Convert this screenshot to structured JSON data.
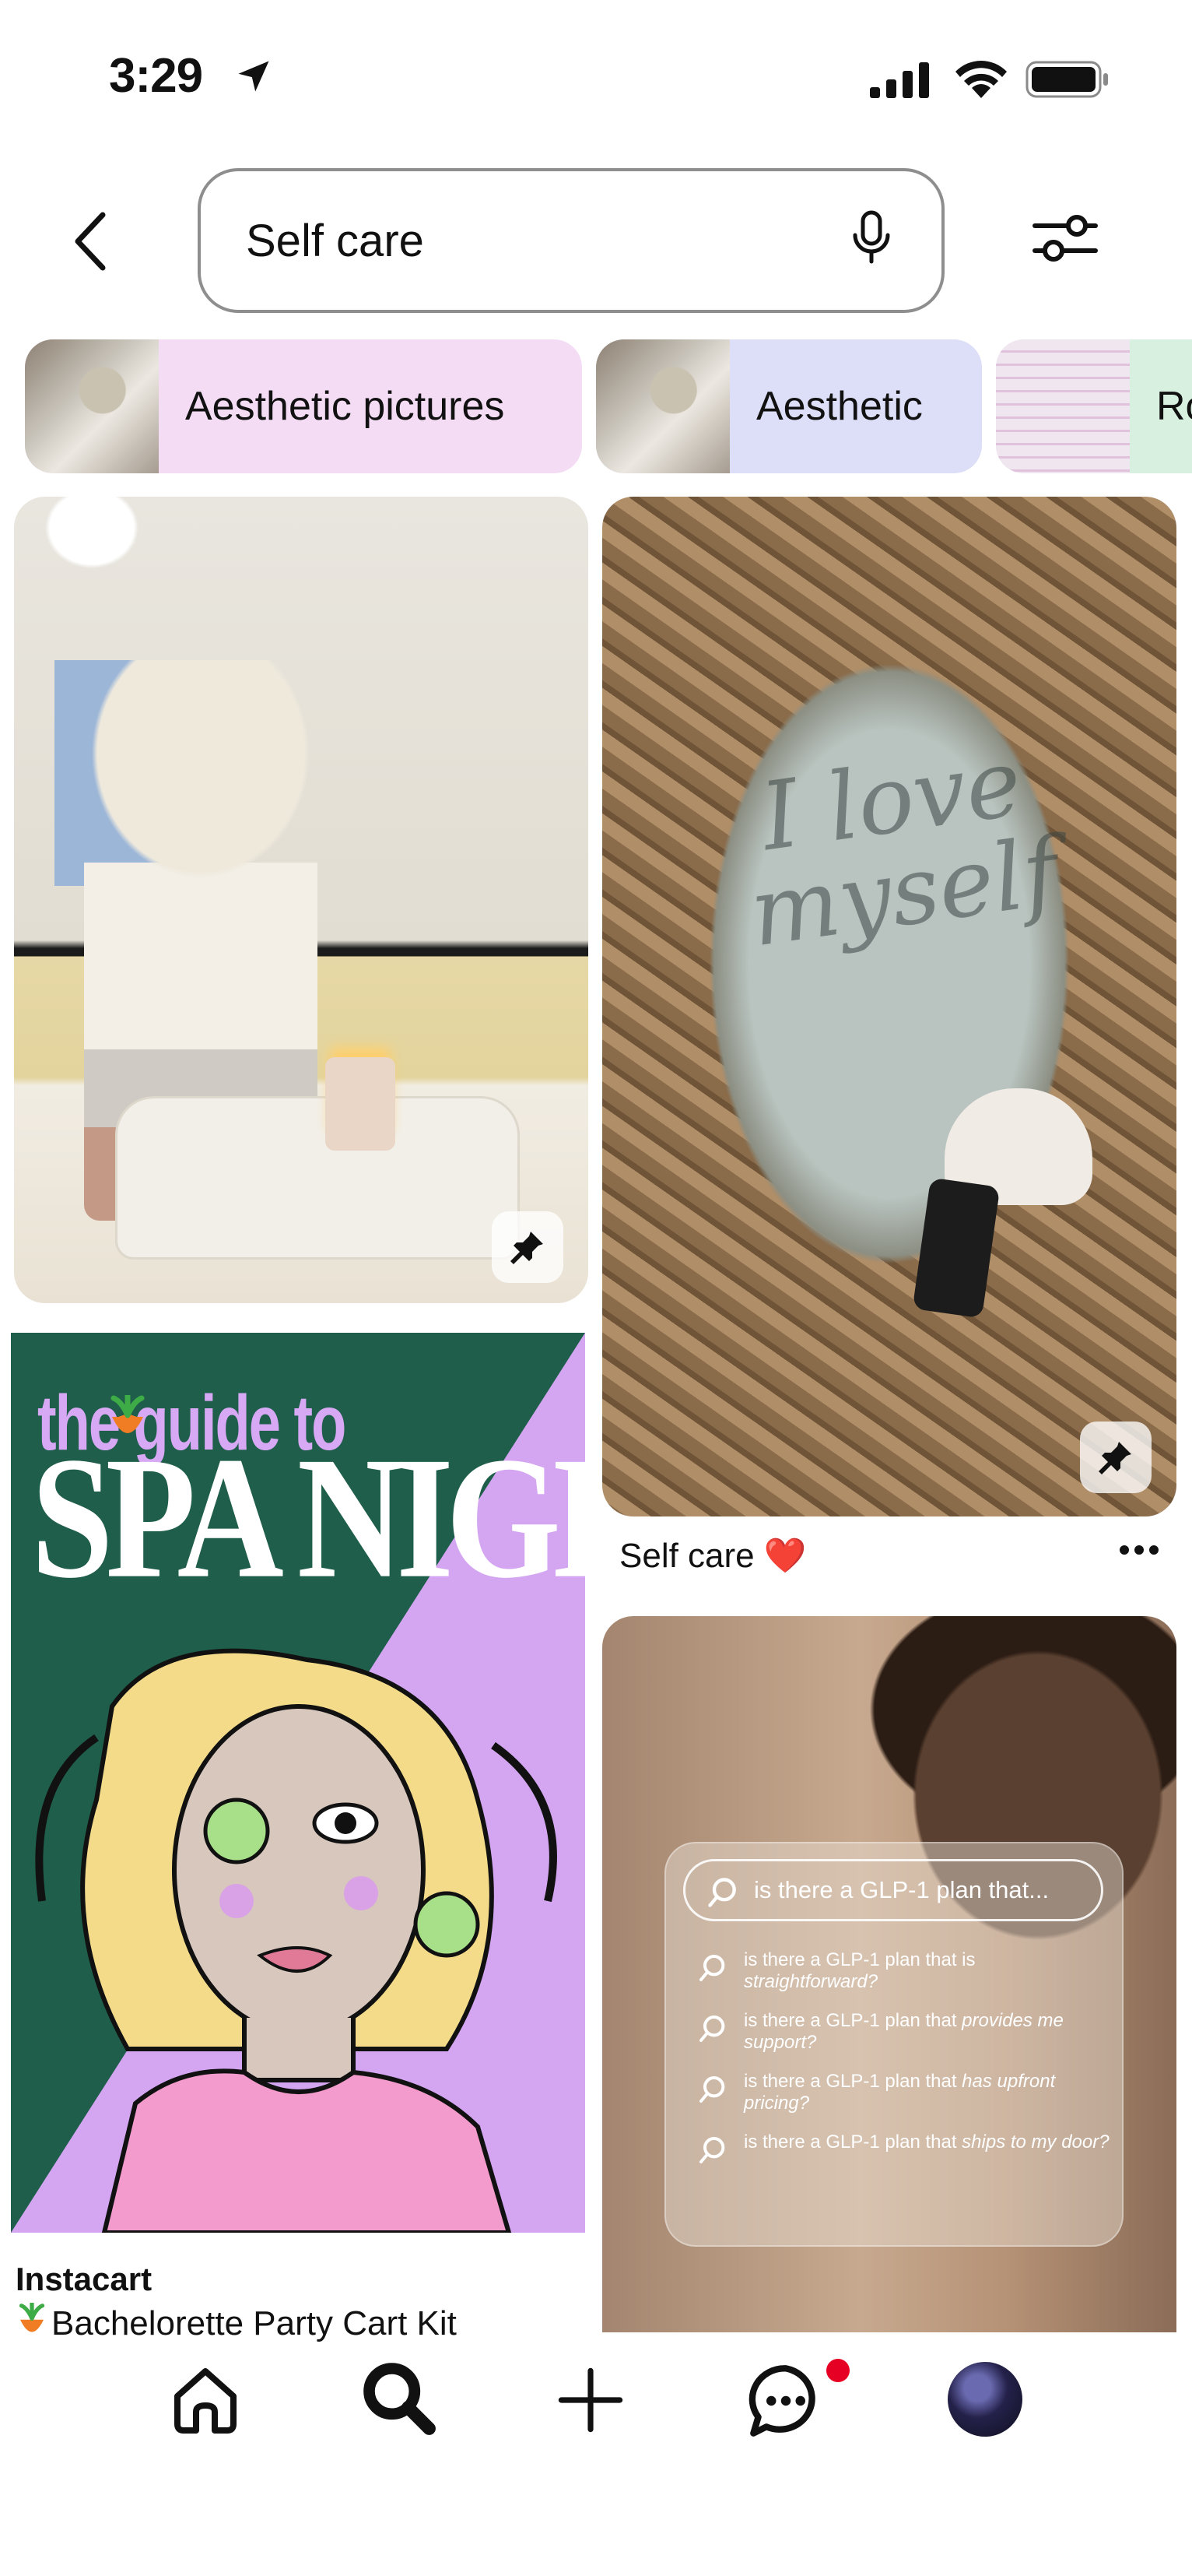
{
  "status_bar": {
    "time": "3:29",
    "icons": [
      "location-arrow-icon",
      "cellular-signal-icon",
      "wifi-icon",
      "battery-icon"
    ]
  },
  "search": {
    "query": "Self care",
    "icons": [
      "back-chevron-icon",
      "microphone-icon",
      "filter-sliders-icon"
    ]
  },
  "chips": [
    {
      "label": "Aesthetic pictures",
      "color": "#f4dcf5"
    },
    {
      "label": "Aesthetic",
      "color": "#dcdff7"
    },
    {
      "label": "Ro",
      "color": "#d8f0df"
    }
  ],
  "pins": {
    "pin1": {
      "save_icon": "pin-icon"
    },
    "pin2": {
      "mirror_text": "I love myself",
      "title": "Self care ❤️",
      "more_icon": "ellipsis-icon",
      "save_icon": "pin-icon"
    },
    "pin3": {
      "headline_small": "the guide to",
      "headline_big": "SPA NIGHT",
      "source": "Instacart",
      "title": "Bachelorette Party Cart Kit",
      "brand_icon": "carrot-icon"
    },
    "pin4": {
      "search_text": "is there a GLP-1 plan that...",
      "items": [
        {
          "prefix": "is there a GLP-1 plan that is",
          "emph": "straightforward?"
        },
        {
          "prefix": "is there a GLP-1 plan that",
          "emph": "provides me support?"
        },
        {
          "prefix": "is there a GLP-1 plan that",
          "emph": "has upfront pricing?"
        },
        {
          "prefix": "is there a GLP-1 plan that",
          "emph": "ships to my door?"
        }
      ]
    }
  },
  "bottom_nav": {
    "items": [
      "home-icon",
      "search-icon",
      "create-plus-icon",
      "messages-icon",
      "profile-avatar"
    ],
    "notification_color": "#e60023"
  }
}
